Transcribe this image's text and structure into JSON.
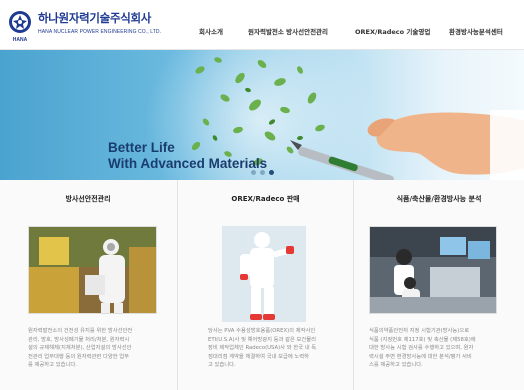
{
  "logo": {
    "title": "하나원자력기술주식회사",
    "subtitle": "HANA NUCLEAR POWER ENGINEERING CO., LTD.",
    "mark_label": "HANA"
  },
  "nav": {
    "items": [
      {
        "label": "회사소개"
      },
      {
        "label": "원자력발전소 방사선안전관리"
      },
      {
        "label": "OREX/Radeco 기술영업"
      },
      {
        "label": "환경방사능분석센터"
      }
    ]
  },
  "banner": {
    "line1": "Better Life",
    "line2": "With Advanced Materials",
    "slide_count": 3,
    "active_slide": 3
  },
  "sections": [
    {
      "title": "방사선안전관리",
      "text": "원자력발전소의 건전성 유지를 위한 방사선안전\n관리, 방호, 방사성폐기물 처리/처분, 원자력시\n설의 규제해체(지체처분), 산업지설의 방사선안\n전관리 업무대행 등의 원자력관련 다양한 업무\n를 제공하고 있습니다."
    },
    {
      "title": "OREX/Radeco 판매",
      "text": "당사는 PVA 수용성방호용품(OREX)의 제작사인\nETI(U.S.A)사 및 예어방광지 등과 같은 보건물리\n장비 제작업체인 Radeco(USA)사 와 한국 내 독\n점대리점 계약을 체결하여 국내 보급에 노력하\n고 있습니다."
    },
    {
      "title": "식품/축산물/환경방사능 분석",
      "text": "식품의약품안전처 지정 시험기관(방사능)으로\n식품 (지정번호 제117호) 및 축산물 (제58호)에\n대한 방사능 시험 검사를 수행하고 있으며, 원자\n력시설 주변 환경방사능에 대한 분석/평가 서비\n스를 제공하고 있습니다."
    }
  ],
  "colors": {
    "brand": "#1f3a93",
    "banner_sky": "#6dbbe0",
    "leaf_green": "#6ab04c"
  }
}
